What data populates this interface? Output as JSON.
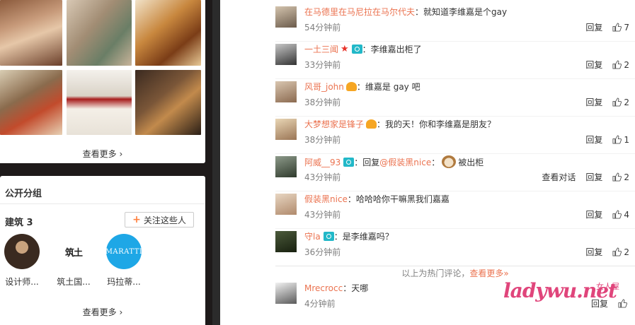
{
  "photos": {
    "more_label": "查看更多",
    "items": [
      "photo-1",
      "photo-2",
      "photo-3",
      "photo-4",
      "photo-5",
      "photo-6"
    ]
  },
  "groups": {
    "title": "公开分组",
    "group_name": "建筑 3",
    "follow_label": "关注这些人",
    "members": [
      {
        "name": "设计师..."
      },
      {
        "name": "筑土国..."
      },
      {
        "name": "玛拉蒂..."
      }
    ],
    "member_logo_text": "筑土",
    "member_logo_text_2": "MARATTI",
    "more_label": "查看更多"
  },
  "comments": [
    {
      "user": "在马德里在马尼拉在马尔代夫",
      "text": "：就知道李维嘉是个gay",
      "time": "54分钟前",
      "reply": "回复",
      "likes": "7"
    },
    {
      "user": "一土三闻",
      "text": "：李维嘉出柜了",
      "time": "33分钟前",
      "reply": "回复",
      "likes": "2"
    },
    {
      "user": "风哥_john",
      "text": "：维嘉是 gay 吧",
      "time": "38分钟前",
      "reply": "回复",
      "likes": "2"
    },
    {
      "user": "大梦想家是锋子",
      "text": "：我的天！你和李维嘉是朋友？",
      "time": "38分钟前",
      "reply": "回复",
      "likes": "1"
    },
    {
      "user": "阿威__93",
      "text_prefix": "：回复",
      "mention": "@假装黑nice",
      "text_suffix": "：",
      "text_after": "被出柜",
      "time": "43分钟前",
      "view_conv": "查看对话",
      "reply": "回复",
      "likes": "2"
    },
    {
      "user": "假装黑nice",
      "text": "：哈哈哈你干嘛黑我们嘉嘉",
      "time": "43分钟前",
      "reply": "回复",
      "likes": "4"
    },
    {
      "user": "守la",
      "text": "：是李维嘉吗？",
      "time": "36分钟前",
      "reply": "回复",
      "likes": "2"
    },
    {
      "user": "Mrecrocc",
      "text": "：天哪",
      "time": "4分钟前",
      "reply": "回复",
      "likes": ""
    }
  ],
  "hot": {
    "prefix": "以上为热门评论，",
    "link": "查看更多»"
  },
  "watermark": {
    "text": "ladywu.net",
    "cn": "女人屋"
  },
  "colors": {
    "username": "#eb7350",
    "camera_badge": "#22b8c8",
    "star_badge": "#e8332a",
    "follow_plus": "#ff8140",
    "maratti_blue": "#1ea7e6"
  }
}
